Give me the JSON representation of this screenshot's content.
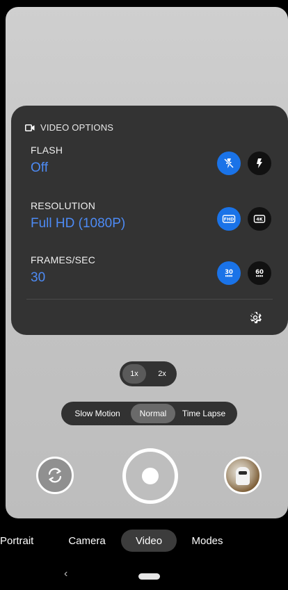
{
  "panel": {
    "header": "VIDEO OPTIONS",
    "rows": [
      {
        "label": "FLASH",
        "value": "Off",
        "buttons": [
          {
            "icon": "flash-off-icon",
            "active": true
          },
          {
            "icon": "flash-on-icon",
            "active": false
          }
        ]
      },
      {
        "label": "RESOLUTION",
        "value": "Full HD (1080P)",
        "buttons": [
          {
            "icon": "fhd-icon",
            "text": "FHD",
            "active": true
          },
          {
            "icon": "4k-icon",
            "text": "4K",
            "active": false
          }
        ]
      },
      {
        "label": "FRAMES/SEC",
        "value": "30",
        "buttons": [
          {
            "icon": "30fps-icon",
            "text": "30",
            "active": true
          },
          {
            "icon": "60fps-icon",
            "text": "60",
            "active": false
          }
        ]
      }
    ]
  },
  "zoom": {
    "options": [
      "1x",
      "2x"
    ],
    "selected": "1x"
  },
  "speed_modes": {
    "options": [
      "Slow Motion",
      "Normal",
      "Time Lapse"
    ],
    "selected": "Normal"
  },
  "bottom_modes": {
    "options": [
      "Portrait",
      "Camera",
      "Video",
      "Modes"
    ],
    "selected": "Video"
  },
  "colors": {
    "accent": "#1a73e8",
    "value_text": "#4d8bf5",
    "panel_bg": "#282828"
  }
}
